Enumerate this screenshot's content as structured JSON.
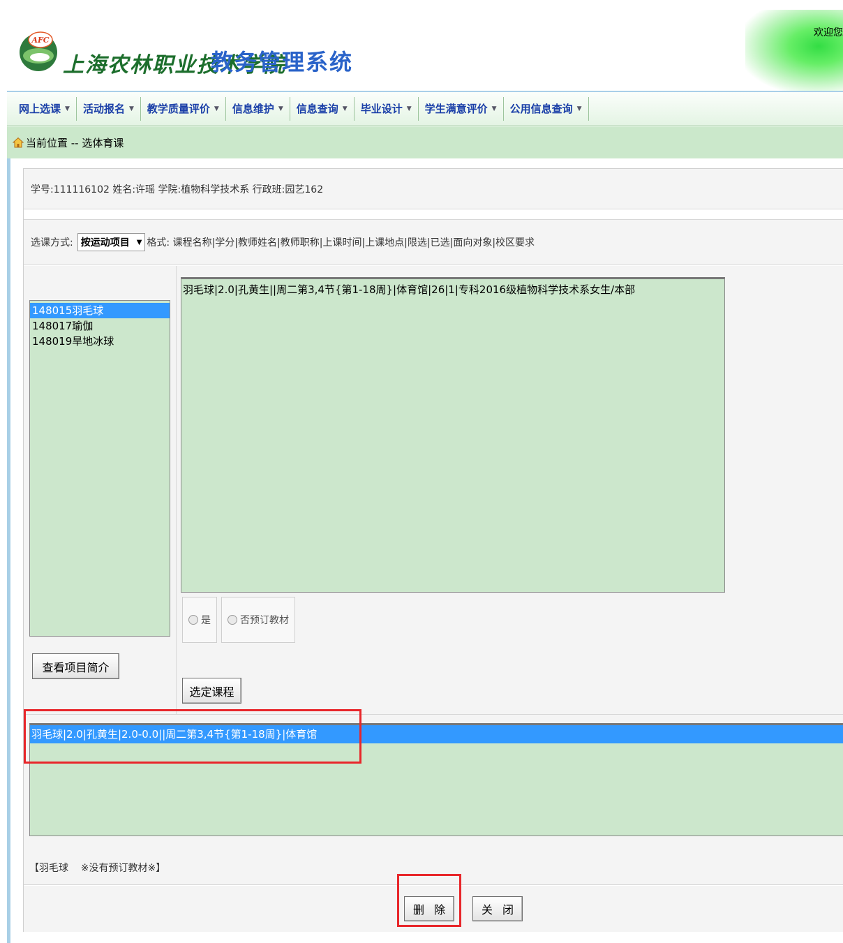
{
  "header": {
    "logo_text": "AFC",
    "school_name": "上海农林职业技术学院",
    "system_name": "教务管理系统",
    "welcome": "欢迎您"
  },
  "nav": {
    "items": [
      {
        "label": "网上选课"
      },
      {
        "label": "活动报名"
      },
      {
        "label": "教学质量评价"
      },
      {
        "label": "信息维护"
      },
      {
        "label": "信息查询"
      },
      {
        "label": "毕业设计"
      },
      {
        "label": "学生满意评价"
      },
      {
        "label": "公用信息查询"
      }
    ],
    "caret_icon": "triangle-down-icon"
  },
  "breadcrumb": {
    "text": "当前位置 -- 选体育课",
    "icon": "home-icon"
  },
  "student_info": "学号:111116102  姓名:许瑶  学院:植物科学技术系  行政班:园艺162",
  "selection_method": {
    "label": "选课方式:",
    "value": "按运动项目",
    "format_text": "格式: 课程名称|学分|教师姓名|教师职称|上课时间|上课地点|限选|已选|面向对象|校区要求"
  },
  "project_list": {
    "items": [
      {
        "label": "148015羽毛球",
        "selected": true
      },
      {
        "label": "148017瑜伽",
        "selected": false
      },
      {
        "label": "148019旱地冰球",
        "selected": false
      }
    ]
  },
  "buttons": {
    "view_intro": "查看项目简介",
    "select_course": "选定课程",
    "delete": "删除",
    "close": "关闭"
  },
  "course_list": {
    "items": [
      {
        "label": "羽毛球|2.0|孔黄生||周二第3,4节{第1-18周}|体育馆|26|1|专科2016级植物科学技术系女生/本部"
      }
    ]
  },
  "textbook_options": {
    "yes_label": "是",
    "no_label": "否预订教材"
  },
  "selected_courses": {
    "items": [
      {
        "label": "羽毛球|2.0|孔黄生|2.0-0.0||周二第3,4节{第1-18周}|体育馆"
      }
    ]
  },
  "textbook_note": "【羽毛球    ※没有预订教材※】",
  "colors": {
    "annotation": "#e8262a",
    "selection": "#3399ff",
    "list_bg": "#cce7cc",
    "nav_text": "#1a3fa8",
    "system_name": "#2a63c9"
  }
}
